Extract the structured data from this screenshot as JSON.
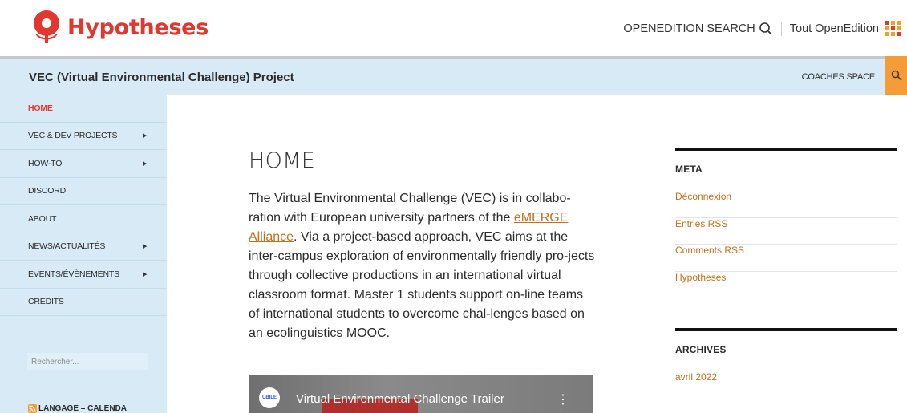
{
  "brand": {
    "name": "Hypotheses",
    "color": "#e2372e"
  },
  "top_nav": {
    "search_label": "OPENEDITION SEARCH",
    "tout_label": "Tout OpenEdition"
  },
  "site": {
    "title": "VEC (Virtual Environmental Challenge) Project",
    "coaches_label": "COACHES SPACE"
  },
  "sidebar": {
    "items": [
      {
        "label": "HOME",
        "active": true,
        "submenu": false
      },
      {
        "label": "VEC & DEV PROJECTS",
        "active": false,
        "submenu": true
      },
      {
        "label": "HOW-TO",
        "active": false,
        "submenu": true
      },
      {
        "label": "DISCORD",
        "active": false,
        "submenu": false
      },
      {
        "label": "ABOUT",
        "active": false,
        "submenu": false
      },
      {
        "label": "NEWS/ACTUALITÉS",
        "active": false,
        "submenu": true
      },
      {
        "label": "EVENTS/ÉVÈNEMENTS",
        "active": false,
        "submenu": true
      },
      {
        "label": "CREDITS",
        "active": false,
        "submenu": false
      }
    ],
    "search_placeholder": "Rechercher...",
    "feed_label": "LANGAGE – CALENDA"
  },
  "main": {
    "title": "HOME",
    "intro_part1": "The Virtual Environmental Challenge (VEC) is in collabo-ration with European university partners of the ",
    "intro_link": "eMERGE Alliance",
    "intro_part2": ". Via a project-based approach, VEC aims at the inter-campus exploration of environmentally friendly pro-jects through collective productions in an international virtual classroom format. Master 1 students support on-line teams of international students to overcome chal-lenges based on an ecolinguistics MOOC.",
    "video": {
      "channel_badge": "UBILE",
      "title": "Virtual Environmental Challenge Trailer"
    }
  },
  "widgets": {
    "meta": {
      "heading": "META",
      "links": [
        "Déconnexion",
        "Entries RSS",
        "Comments RSS",
        "Hypotheses"
      ]
    },
    "archives": {
      "heading": "ARCHIVES",
      "links": [
        "avril 2022"
      ]
    }
  },
  "colors": {
    "accent": "#f39c38",
    "link": "#c46f1b",
    "header_bg": "#d7eaf6"
  }
}
